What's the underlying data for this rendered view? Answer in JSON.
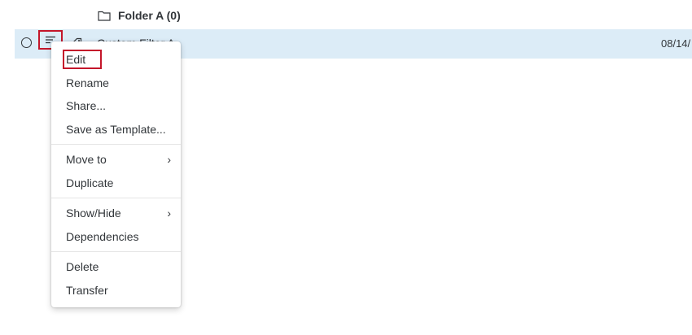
{
  "folder": {
    "label": "Folder A (0)"
  },
  "item": {
    "name": "Custom Filter A",
    "date": "08/14/"
  },
  "menu": {
    "groups": [
      [
        {
          "label": "Edit",
          "highlighted": true
        },
        {
          "label": "Rename"
        },
        {
          "label": "Share..."
        },
        {
          "label": "Save as Template..."
        }
      ],
      [
        {
          "label": "Move to",
          "submenu": true
        },
        {
          "label": "Duplicate"
        }
      ],
      [
        {
          "label": "Show/Hide",
          "submenu": true
        },
        {
          "label": "Dependencies"
        }
      ],
      [
        {
          "label": "Delete"
        },
        {
          "label": "Transfer"
        }
      ]
    ],
    "chevron": "›"
  },
  "colors": {
    "row_selected": "#dcecf7",
    "highlight_border": "#c4162a",
    "text": "#32363a"
  },
  "icons": [
    "folder-icon",
    "radio-icon",
    "menu-lines-icon",
    "tag-icon",
    "chevron-right-icon"
  ]
}
